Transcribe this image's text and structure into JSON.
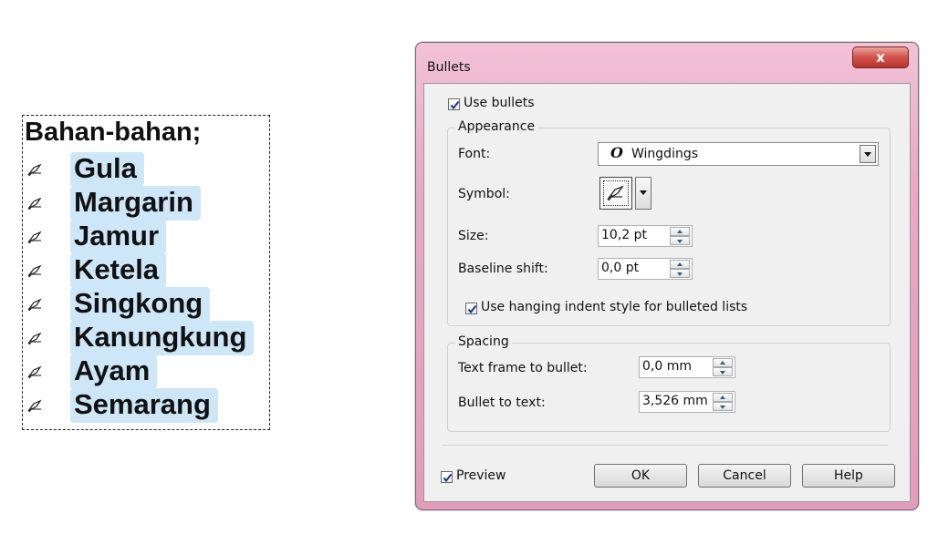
{
  "text_frame": {
    "title": "Bahan-bahan;",
    "items": [
      "Gula",
      "Margarin",
      "Jamur",
      "Ketela",
      "Singkong",
      "Kanungkung",
      "Ayam",
      "Semarang"
    ]
  },
  "dialog": {
    "title": "Bullets",
    "close_label": "x",
    "use_bullets": {
      "label": "Use bullets",
      "checked": true
    },
    "appearance": {
      "legend": "Appearance",
      "font_label": "Font:",
      "font_glyph": "O",
      "font_value": "Wingdings",
      "symbol_label": "Symbol:",
      "size_label": "Size:",
      "size_value": "10,2 pt",
      "baseline_label": "Baseline shift:",
      "baseline_value": "0,0 pt",
      "hanging_indent": {
        "label": "Use hanging indent style for bulleted lists",
        "checked": true
      }
    },
    "spacing": {
      "legend": "Spacing",
      "frame_to_bullet_label": "Text frame to bullet:",
      "frame_to_bullet_value": "0,0 mm",
      "bullet_to_text_label": "Bullet to text:",
      "bullet_to_text_value": "3,526 mm"
    },
    "preview": {
      "label": "Preview",
      "checked": true
    },
    "buttons": {
      "ok": "OK",
      "cancel": "Cancel",
      "help": "Help"
    }
  },
  "icons": {
    "bullet": "writing-hand-icon",
    "checkbox": "checkmark-icon"
  },
  "colors": {
    "highlight": "#cde6f8",
    "titlebar": "#e9a9c5",
    "close": "#c9423a"
  }
}
